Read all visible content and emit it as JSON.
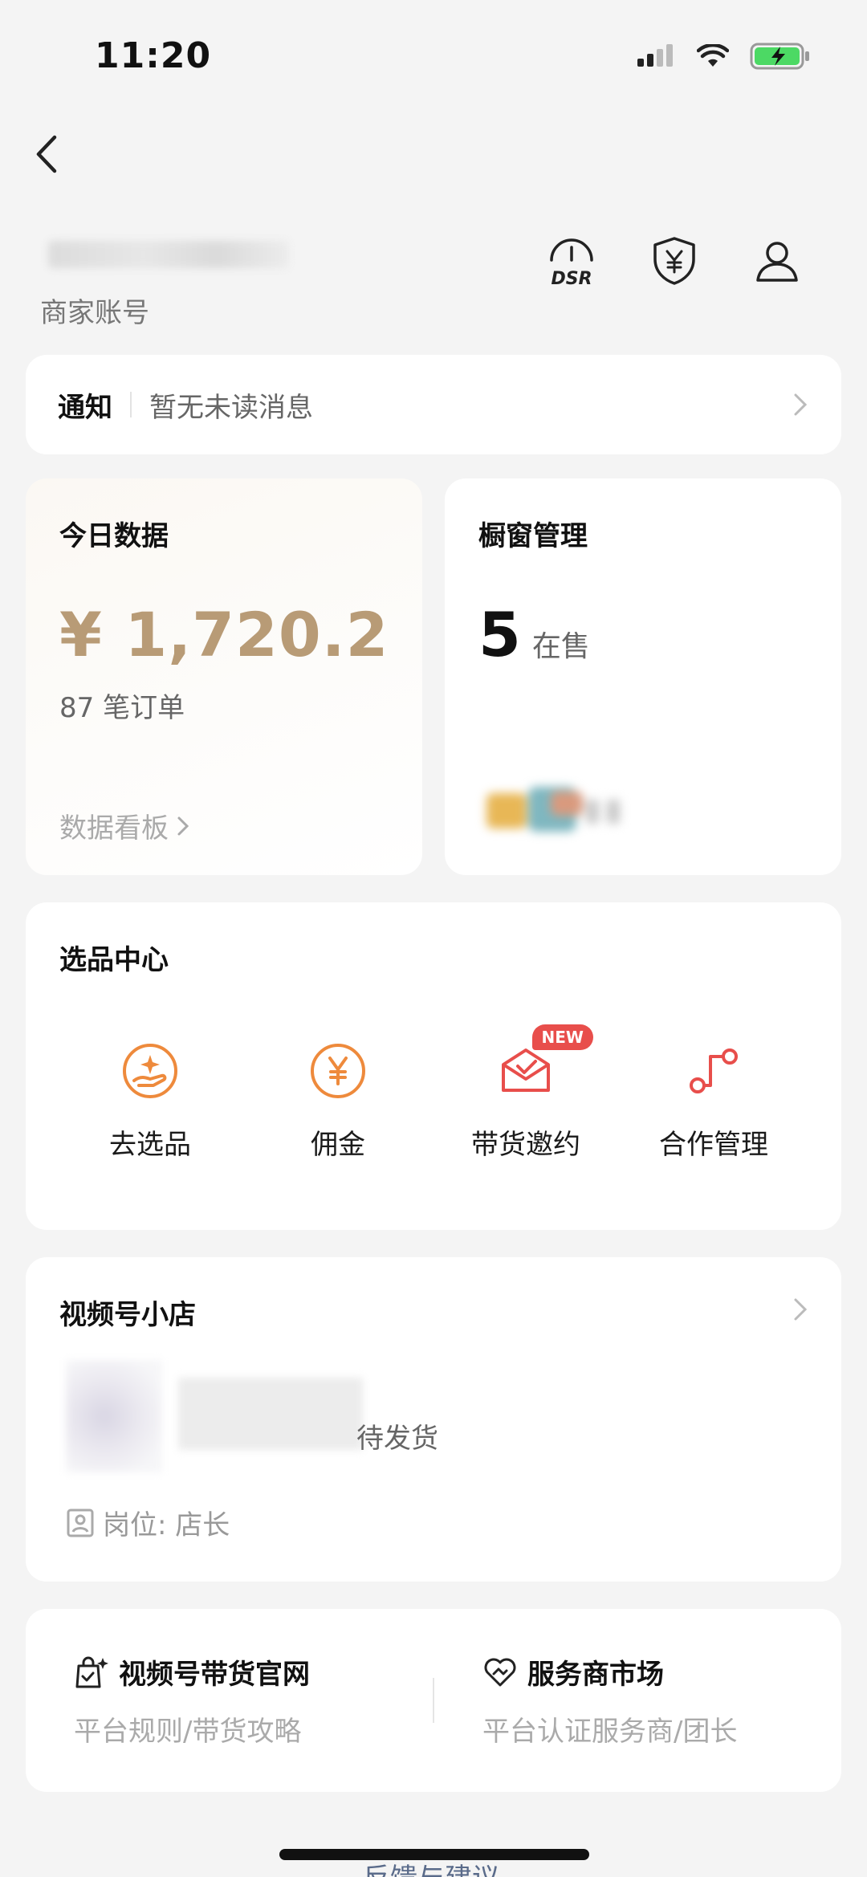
{
  "status_bar": {
    "time": "11:20"
  },
  "account": {
    "type_label": "商家账号"
  },
  "header_icons": {
    "dsr_label": "DSR"
  },
  "notice": {
    "title": "通知",
    "text": "暂无未读消息"
  },
  "today": {
    "title": "今日数据",
    "amount": "¥ 1,720.2",
    "orders": "87 笔订单",
    "link": "数据看板"
  },
  "showcase": {
    "title": "橱窗管理",
    "count": "5",
    "count_label": "在售"
  },
  "picker": {
    "title": "选品中心",
    "badge": "NEW",
    "items": [
      {
        "label": "去选品"
      },
      {
        "label": "佣金"
      },
      {
        "label": "带货邀约"
      },
      {
        "label": "合作管理"
      }
    ]
  },
  "shop": {
    "title": "视频号小店",
    "pending": "待发货",
    "role": "岗位: 店长"
  },
  "links": {
    "left_title": "视频号带货官网",
    "left_sub": "平台规则/带货攻略",
    "right_title": "服务商市场",
    "right_sub": "平台认证服务商/团长"
  },
  "footer": {
    "feedback": "反馈与建议"
  },
  "colors": {
    "accent_gold": "#b89b76",
    "orange": "#ee8a3c",
    "red": "#e84e4b"
  }
}
